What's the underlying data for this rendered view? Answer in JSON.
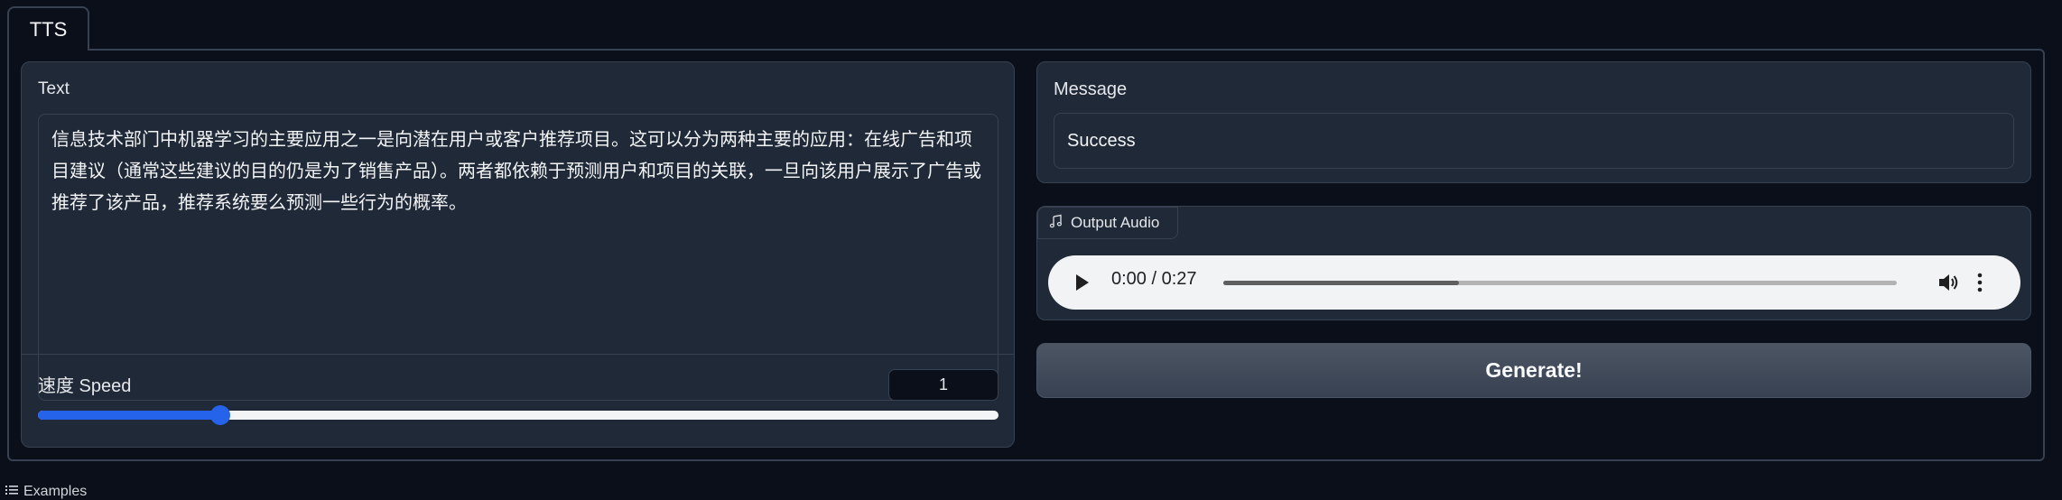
{
  "tabs": [
    {
      "label": "TTS"
    }
  ],
  "text_block": {
    "label": "Text",
    "value": "信息技术部门中机器学习的主要应用之一是向潜在用户或客户推荐项目。这可以分为两种主要的应用：在线广告和项目建议（通常这些建议的目的仍是为了销售产品）。两者都依赖于预测用户和项目的关联，一旦向该用户展示了广告或推荐了该产品，推荐系统要么预测一些行为的概率。"
  },
  "speed": {
    "label": "速度 Speed",
    "value": "1",
    "slider_fraction": 0.19
  },
  "message": {
    "label": "Message",
    "value": "Success"
  },
  "output_audio": {
    "label": "Output Audio",
    "icon": "music-note-icon",
    "time": "0:00 / 0:27",
    "progress_fraction": 0.35
  },
  "generate_button": {
    "label": "Generate!"
  },
  "examples": {
    "label": "Examples",
    "icon": "list-icon"
  },
  "colors": {
    "background": "#0b0f19",
    "panel": "#1f2937",
    "accent": "#2563eb"
  }
}
